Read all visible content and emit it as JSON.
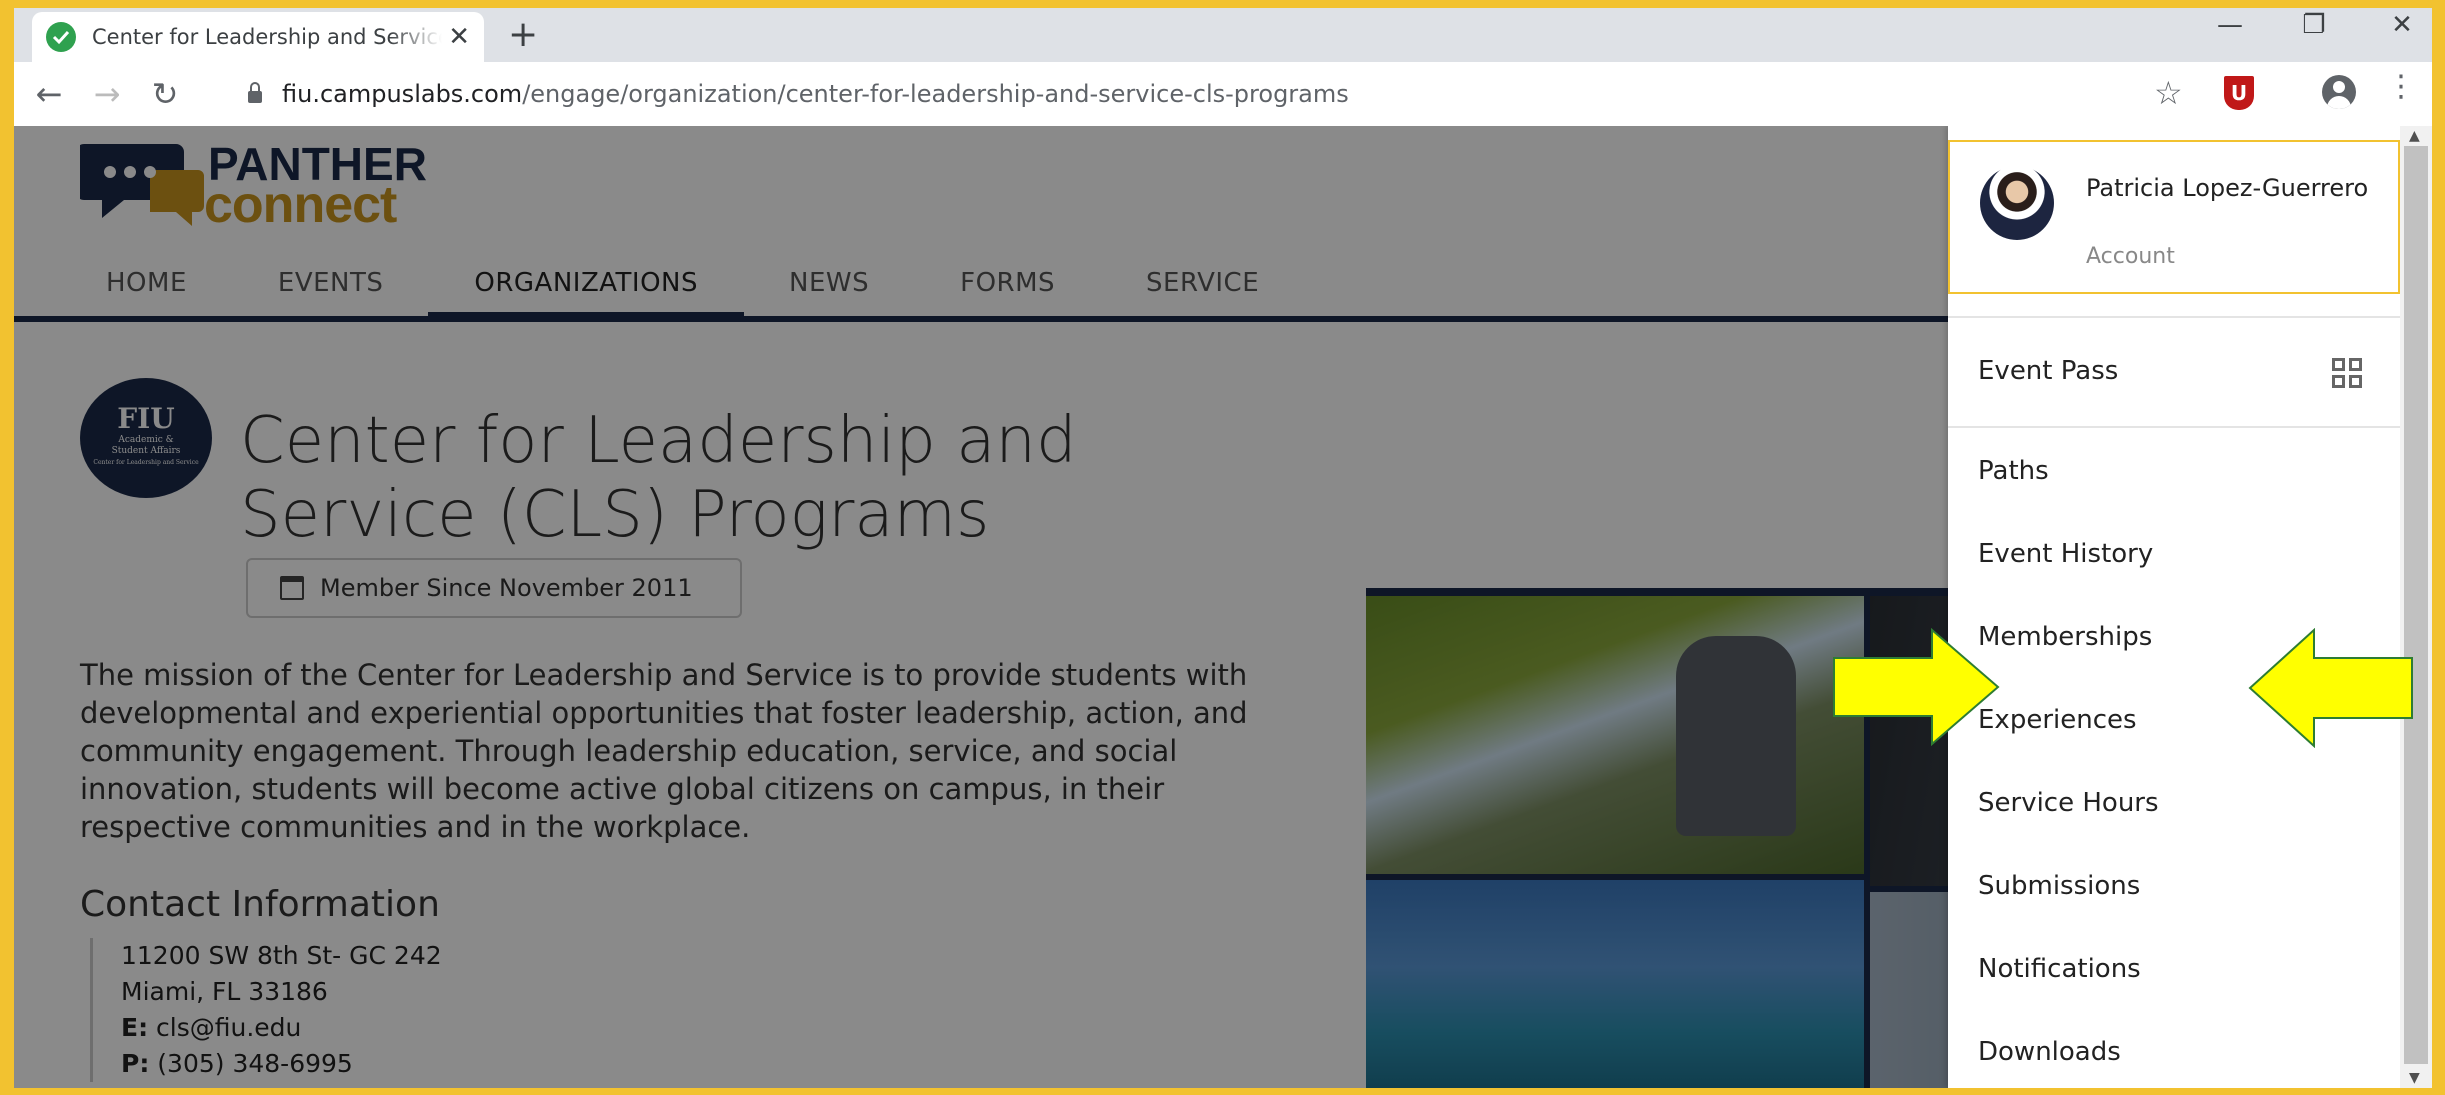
{
  "browser": {
    "tab_title": "Center for Leadership and Service (CLS) Programs",
    "new_tab_symbol": "+",
    "tab_close_symbol": "✕",
    "window_minimize": "—",
    "window_restore": "❐",
    "window_close": "✕",
    "url_host": "fiu.campuslabs.com",
    "url_path": "/engage/organization/center-for-leadership-and-service-cls-programs",
    "extension_label": "U"
  },
  "site": {
    "logo_top": "PANTHER",
    "logo_bottom": "connect",
    "nav": [
      "HOME",
      "EVENTS",
      "ORGANIZATIONS",
      "NEWS",
      "FORMS",
      "SERVICE"
    ],
    "active_nav": "ORGANIZATIONS"
  },
  "org": {
    "logo_big": "FIU",
    "logo_line1": "Academic &",
    "logo_line2": "Student Affairs",
    "logo_line3": "Center for Leadership and Service",
    "title": "Center for Leadership and Service (CLS) Programs",
    "member_since": "Member Since November 2011",
    "mission": "The mission of the Center for Leadership and Service is to provide students with developmental and experiential opportunities that foster leadership, action, and community engagement. Through leadership education, service, and social innovation, students will become active global citizens on campus, in their respective communities and in the workplace.",
    "contact_heading": "Contact Information",
    "address1": "11200 SW 8th St- GC 242",
    "address2": "Miami, FL 33186",
    "email_label": "E:",
    "email": "cls@fiu.edu",
    "phone_label": "P:",
    "phone": "(305) 348-6995"
  },
  "menu": {
    "user_name": "Patricia Lopez-Guerrero",
    "account_label": "Account",
    "items": [
      "Event Pass",
      "Paths",
      "Event History",
      "Memberships",
      "Experiences",
      "Service Hours",
      "Submissions",
      "Notifications",
      "Downloads"
    ]
  },
  "colors": {
    "frame": "#f2c230",
    "navy": "#1b2a48",
    "arrow": "#ffff00",
    "arrow_outline": "#2e7d32"
  }
}
